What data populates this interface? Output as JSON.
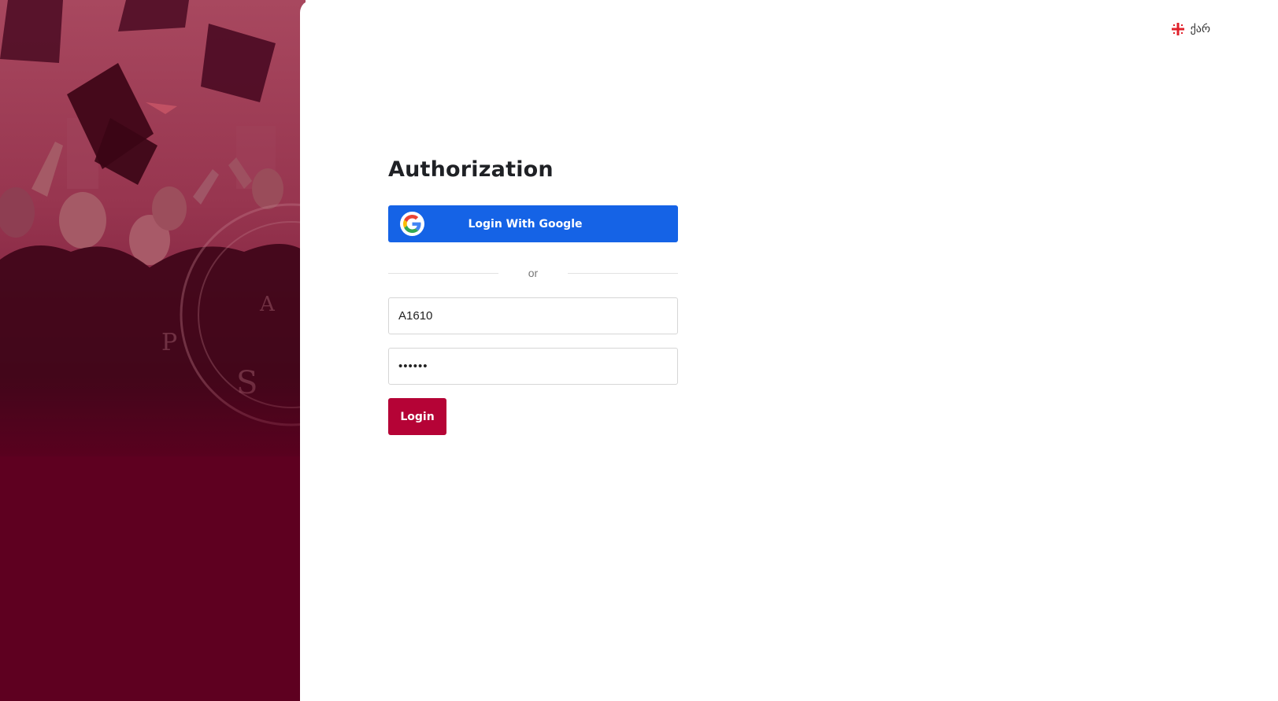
{
  "language": {
    "icon": "georgian-flag-icon",
    "label": "ქარ"
  },
  "auth": {
    "title": "Authorization",
    "google_button": {
      "icon": "google-g-icon",
      "label": "Login With Google"
    },
    "divider_text": "or",
    "username": {
      "value": "A1610"
    },
    "password": {
      "value": "••••••"
    },
    "login_button": "Login"
  },
  "colors": {
    "brand_maroon": "#5e0020",
    "login_button": "#b50336",
    "google_button": "#1563e6"
  }
}
